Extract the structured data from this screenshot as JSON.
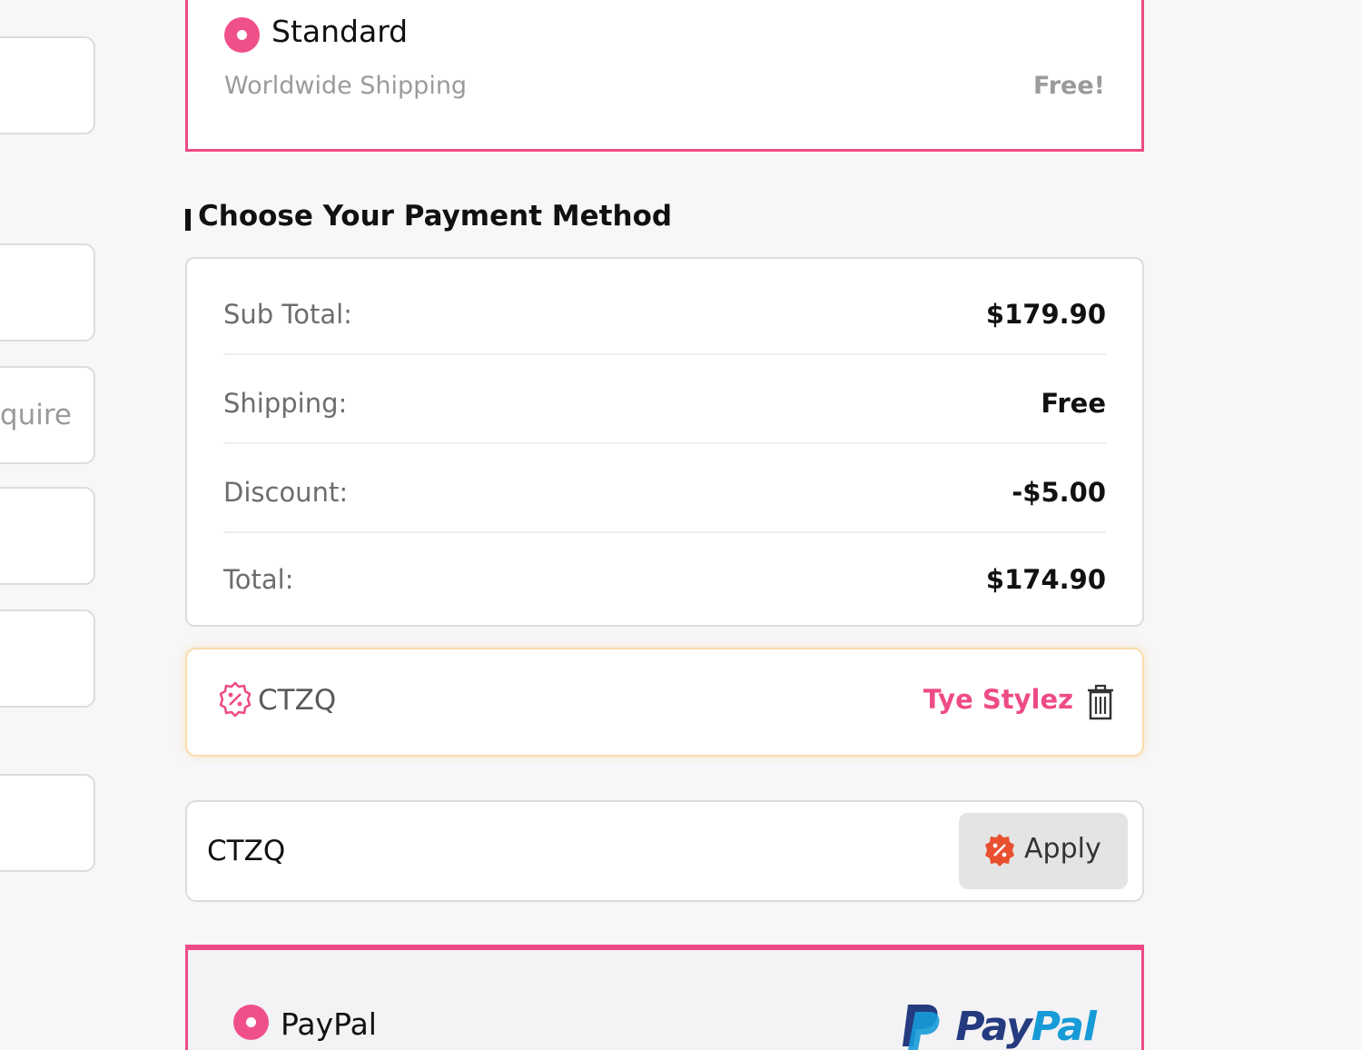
{
  "left_column": {
    "partial_text": "equire"
  },
  "shipping_option": {
    "name": "Standard",
    "subtitle": "Worldwide Shipping",
    "price": "Free!"
  },
  "payment_section": {
    "title": "Choose Your Payment Method"
  },
  "summary": {
    "rows": [
      {
        "label": "Sub Total:",
        "value": "$179.90"
      },
      {
        "label": "Shipping:",
        "value": "Free"
      },
      {
        "label": "Discount:",
        "value": "-$5.00"
      },
      {
        "label": "Total:",
        "value": "$174.90"
      }
    ]
  },
  "applied_coupon": {
    "code": "CTZQ",
    "owner": "Tye Stylez"
  },
  "coupon_input": {
    "value": "CTZQ",
    "apply_label": "Apply"
  },
  "payment_option": {
    "name": "PayPal",
    "logo_pay": "Pay",
    "logo_pal": "Pal"
  },
  "colors": {
    "accent": "#ee4b86",
    "coupon_border": "#fbdcab",
    "paypal_dark": "#253b80",
    "paypal_light": "#179bd7"
  }
}
